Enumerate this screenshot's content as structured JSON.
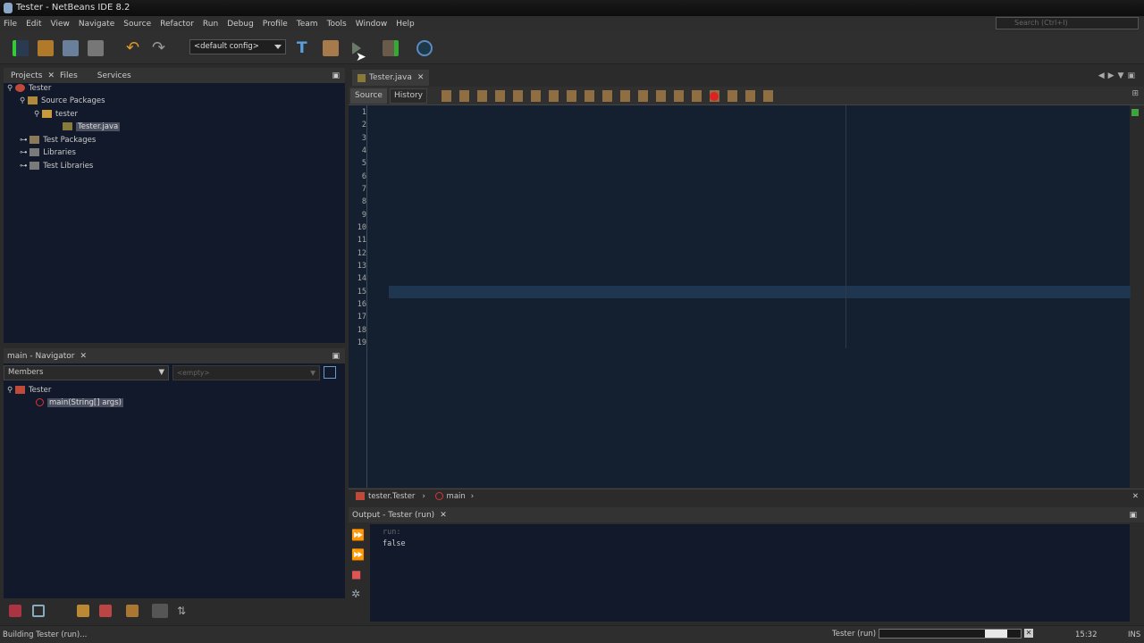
{
  "window": {
    "title": "Tester - NetBeans IDE 8.2"
  },
  "menu": [
    "File",
    "Edit",
    "View",
    "Navigate",
    "Source",
    "Refactor",
    "Run",
    "Debug",
    "Profile",
    "Team",
    "Tools",
    "Window",
    "Help"
  ],
  "search": {
    "placeholder": "Search (Ctrl+I)"
  },
  "toolbar": {
    "config": "<default config>"
  },
  "projects": {
    "tabs": [
      "Projects",
      "Files",
      "Services"
    ],
    "tree": [
      "Tester",
      "Source Packages",
      "tester",
      "Tester.java",
      "Test Packages",
      "Libraries",
      "Test Libraries"
    ]
  },
  "navigator": {
    "title": "main - Navigator",
    "filter": "Members",
    "empty": "<empty>",
    "tree": [
      "Tester",
      "main(String[] args)"
    ]
  },
  "editor": {
    "tab": "Tester.java",
    "source": "Source",
    "history": "History",
    "lines": [
      "1",
      "2",
      "3",
      "4",
      "5",
      "6",
      "7",
      "8",
      "9",
      "10",
      "11",
      "12",
      "13",
      "14",
      "15",
      "16",
      "17",
      "18",
      "19"
    ]
  },
  "breadcrumb": [
    "tester.Tester",
    "main"
  ],
  "output": {
    "title": "Output - Tester (run)",
    "lines": [
      "run:",
      "false"
    ]
  },
  "status": {
    "left": "Building Tester (run)...",
    "task": "Tester (run)",
    "time": "15:32",
    "mode": "INS",
    "progress": "indeterminate"
  },
  "colors": {
    "editor_bg": "#14202f",
    "keyword": "#d9a441",
    "comment": "#5a78b0"
  }
}
